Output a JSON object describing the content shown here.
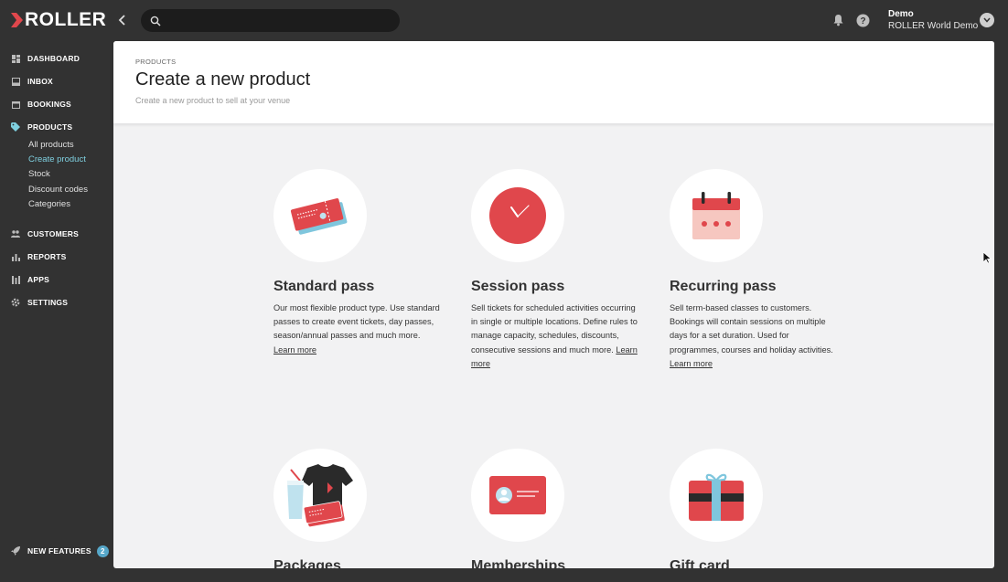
{
  "app": {
    "logo_text": "ROLLER",
    "search_placeholder": "",
    "user_name": "Demo",
    "venue_name": "ROLLER World Demo",
    "accent_color": "#e0474c"
  },
  "sidebar": {
    "items": [
      {
        "label": "DASHBOARD",
        "icon": "dashboard-icon"
      },
      {
        "label": "INBOX",
        "icon": "inbox-icon"
      },
      {
        "label": "BOOKINGS",
        "icon": "calendar-icon"
      },
      {
        "label": "PRODUCTS",
        "icon": "tag-icon"
      },
      {
        "label": "CUSTOMERS",
        "icon": "people-icon"
      },
      {
        "label": "REPORTS",
        "icon": "bar-chart-icon"
      },
      {
        "label": "APPS",
        "icon": "apps-icon"
      },
      {
        "label": "SETTINGS",
        "icon": "gear-icon"
      }
    ],
    "products_sub": [
      {
        "label": "All products"
      },
      {
        "label": "Create product"
      },
      {
        "label": "Stock"
      },
      {
        "label": "Discount codes"
      },
      {
        "label": "Categories"
      }
    ],
    "new_features": {
      "label": "NEW FEATURES",
      "count": "2"
    }
  },
  "header": {
    "breadcrumb": "PRODUCTS",
    "title": "Create a new product",
    "subtitle": "Create a new product to sell at your venue"
  },
  "cards": [
    {
      "title": "Standard pass",
      "desc": "Our most flexible product type. Use standard passes to create event tickets, day passes, season/annual passes and much more.",
      "link": "Learn more",
      "icon": "tickets-icon"
    },
    {
      "title": "Session pass",
      "desc": "Sell tickets for scheduled activities occurring in single or multiple locations. Define rules to manage capacity, schedules, discounts, consecutive sessions and much more.",
      "link": "Learn more",
      "icon": "clock-icon"
    },
    {
      "title": "Recurring pass",
      "desc": "Sell term-based classes to customers. Bookings will contain sessions on multiple days for a set duration. Used for programmes, courses and holiday activities.",
      "link": "Learn more",
      "icon": "calendar-icon"
    },
    {
      "title": "Packages",
      "icon": "package-icon"
    },
    {
      "title": "Memberships",
      "icon": "membership-card-icon"
    },
    {
      "title": "Gift card",
      "icon": "gift-card-icon"
    }
  ]
}
